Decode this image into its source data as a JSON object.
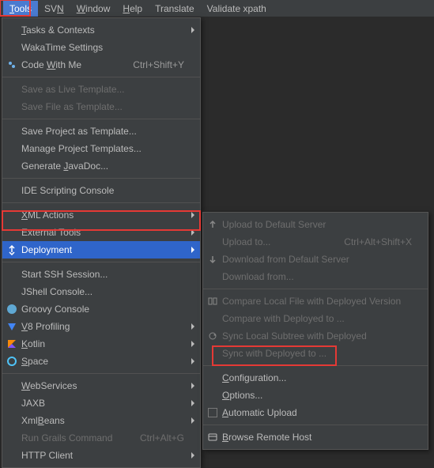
{
  "menubar": {
    "items": [
      {
        "label": "Tools",
        "underline_index": 0,
        "selected": true
      },
      {
        "label": "SVN",
        "underline_index": 2
      },
      {
        "label": "Window",
        "underline_index": 0
      },
      {
        "label": "Help",
        "underline_index": 0
      },
      {
        "label": "Translate"
      },
      {
        "label": "Validate xpath"
      }
    ]
  },
  "dropdown": {
    "items": [
      {
        "type": "item",
        "label": "Tasks & Contexts",
        "underline_index": 0,
        "submenu": true
      },
      {
        "type": "item",
        "label": "WakaTime Settings"
      },
      {
        "type": "item",
        "label": "Code With Me",
        "underline_index": 5,
        "icon": "code-with-me-icon",
        "shortcut": "Ctrl+Shift+Y"
      },
      {
        "type": "sep"
      },
      {
        "type": "item",
        "label": "Save as Live Template...",
        "disabled": true
      },
      {
        "type": "item",
        "label": "Save File as Template...",
        "disabled": true
      },
      {
        "type": "sep"
      },
      {
        "type": "item",
        "label": "Save Project as Template..."
      },
      {
        "type": "item",
        "label": "Manage Project Templates..."
      },
      {
        "type": "item",
        "label": "Generate JavaDoc...",
        "underline_index": 9
      },
      {
        "type": "sep"
      },
      {
        "type": "item",
        "label": "IDE Scripting Console"
      },
      {
        "type": "sep"
      },
      {
        "type": "item",
        "label": "XML Actions",
        "underline_index": 0,
        "submenu": true
      },
      {
        "type": "item",
        "label": "External Tools",
        "submenu": true
      },
      {
        "type": "item",
        "label": "Deployment",
        "icon": "deployment-icon",
        "submenu": true,
        "highlight": true
      },
      {
        "type": "sep"
      },
      {
        "type": "item",
        "label": "Start SSH Session..."
      },
      {
        "type": "item",
        "label": "JShell Console..."
      },
      {
        "type": "item",
        "label": "Groovy Console",
        "icon": "groovy-icon"
      },
      {
        "type": "item",
        "label": "V8 Profiling",
        "underline_index": 0,
        "icon": "v8-icon",
        "submenu": true
      },
      {
        "type": "item",
        "label": "Kotlin",
        "underline_index": 0,
        "icon": "kotlin-icon",
        "submenu": true
      },
      {
        "type": "item",
        "label": "Space",
        "underline_index": 0,
        "icon": "space-icon",
        "submenu": true
      },
      {
        "type": "sep"
      },
      {
        "type": "item",
        "label": "WebServices",
        "underline_index": 0,
        "submenu": true
      },
      {
        "type": "item",
        "label": "JAXB",
        "submenu": true
      },
      {
        "type": "item",
        "label": "XmlBeans",
        "underline_index": 3,
        "submenu": true
      },
      {
        "type": "item",
        "label": "Run Grails Command",
        "disabled": true,
        "shortcut": "Ctrl+Alt+G"
      },
      {
        "type": "item",
        "label": "HTTP Client",
        "submenu": true
      }
    ]
  },
  "submenu": {
    "items": [
      {
        "type": "item",
        "label": "Upload to Default Server",
        "disabled": true,
        "icon": "upload-icon"
      },
      {
        "type": "item",
        "label": "Upload to...",
        "disabled": true,
        "shortcut": "Ctrl+Alt+Shift+X"
      },
      {
        "type": "item",
        "label": "Download from Default Server",
        "disabled": true,
        "icon": "download-icon"
      },
      {
        "type": "item",
        "label": "Download from...",
        "disabled": true
      },
      {
        "type": "sep"
      },
      {
        "type": "item",
        "label": "Compare Local File with Deployed Version",
        "disabled": true,
        "icon": "compare-icon"
      },
      {
        "type": "item",
        "label": "Compare with Deployed to ...",
        "disabled": true
      },
      {
        "type": "item",
        "label": "Sync Local Subtree with Deployed",
        "disabled": true,
        "icon": "sync-icon"
      },
      {
        "type": "item",
        "label": "Sync with Deployed to ...",
        "disabled": true
      },
      {
        "type": "sep"
      },
      {
        "type": "item",
        "label": "Configuration...",
        "underline_index": 0
      },
      {
        "type": "item",
        "label": "Options...",
        "underline_index": 0
      },
      {
        "type": "item",
        "label": "Automatic Upload",
        "underline_index": 0,
        "checkbox": true
      },
      {
        "type": "sep"
      },
      {
        "type": "item",
        "label": "Browse Remote Host",
        "underline_index": 0,
        "icon": "browse-host-icon"
      }
    ]
  }
}
